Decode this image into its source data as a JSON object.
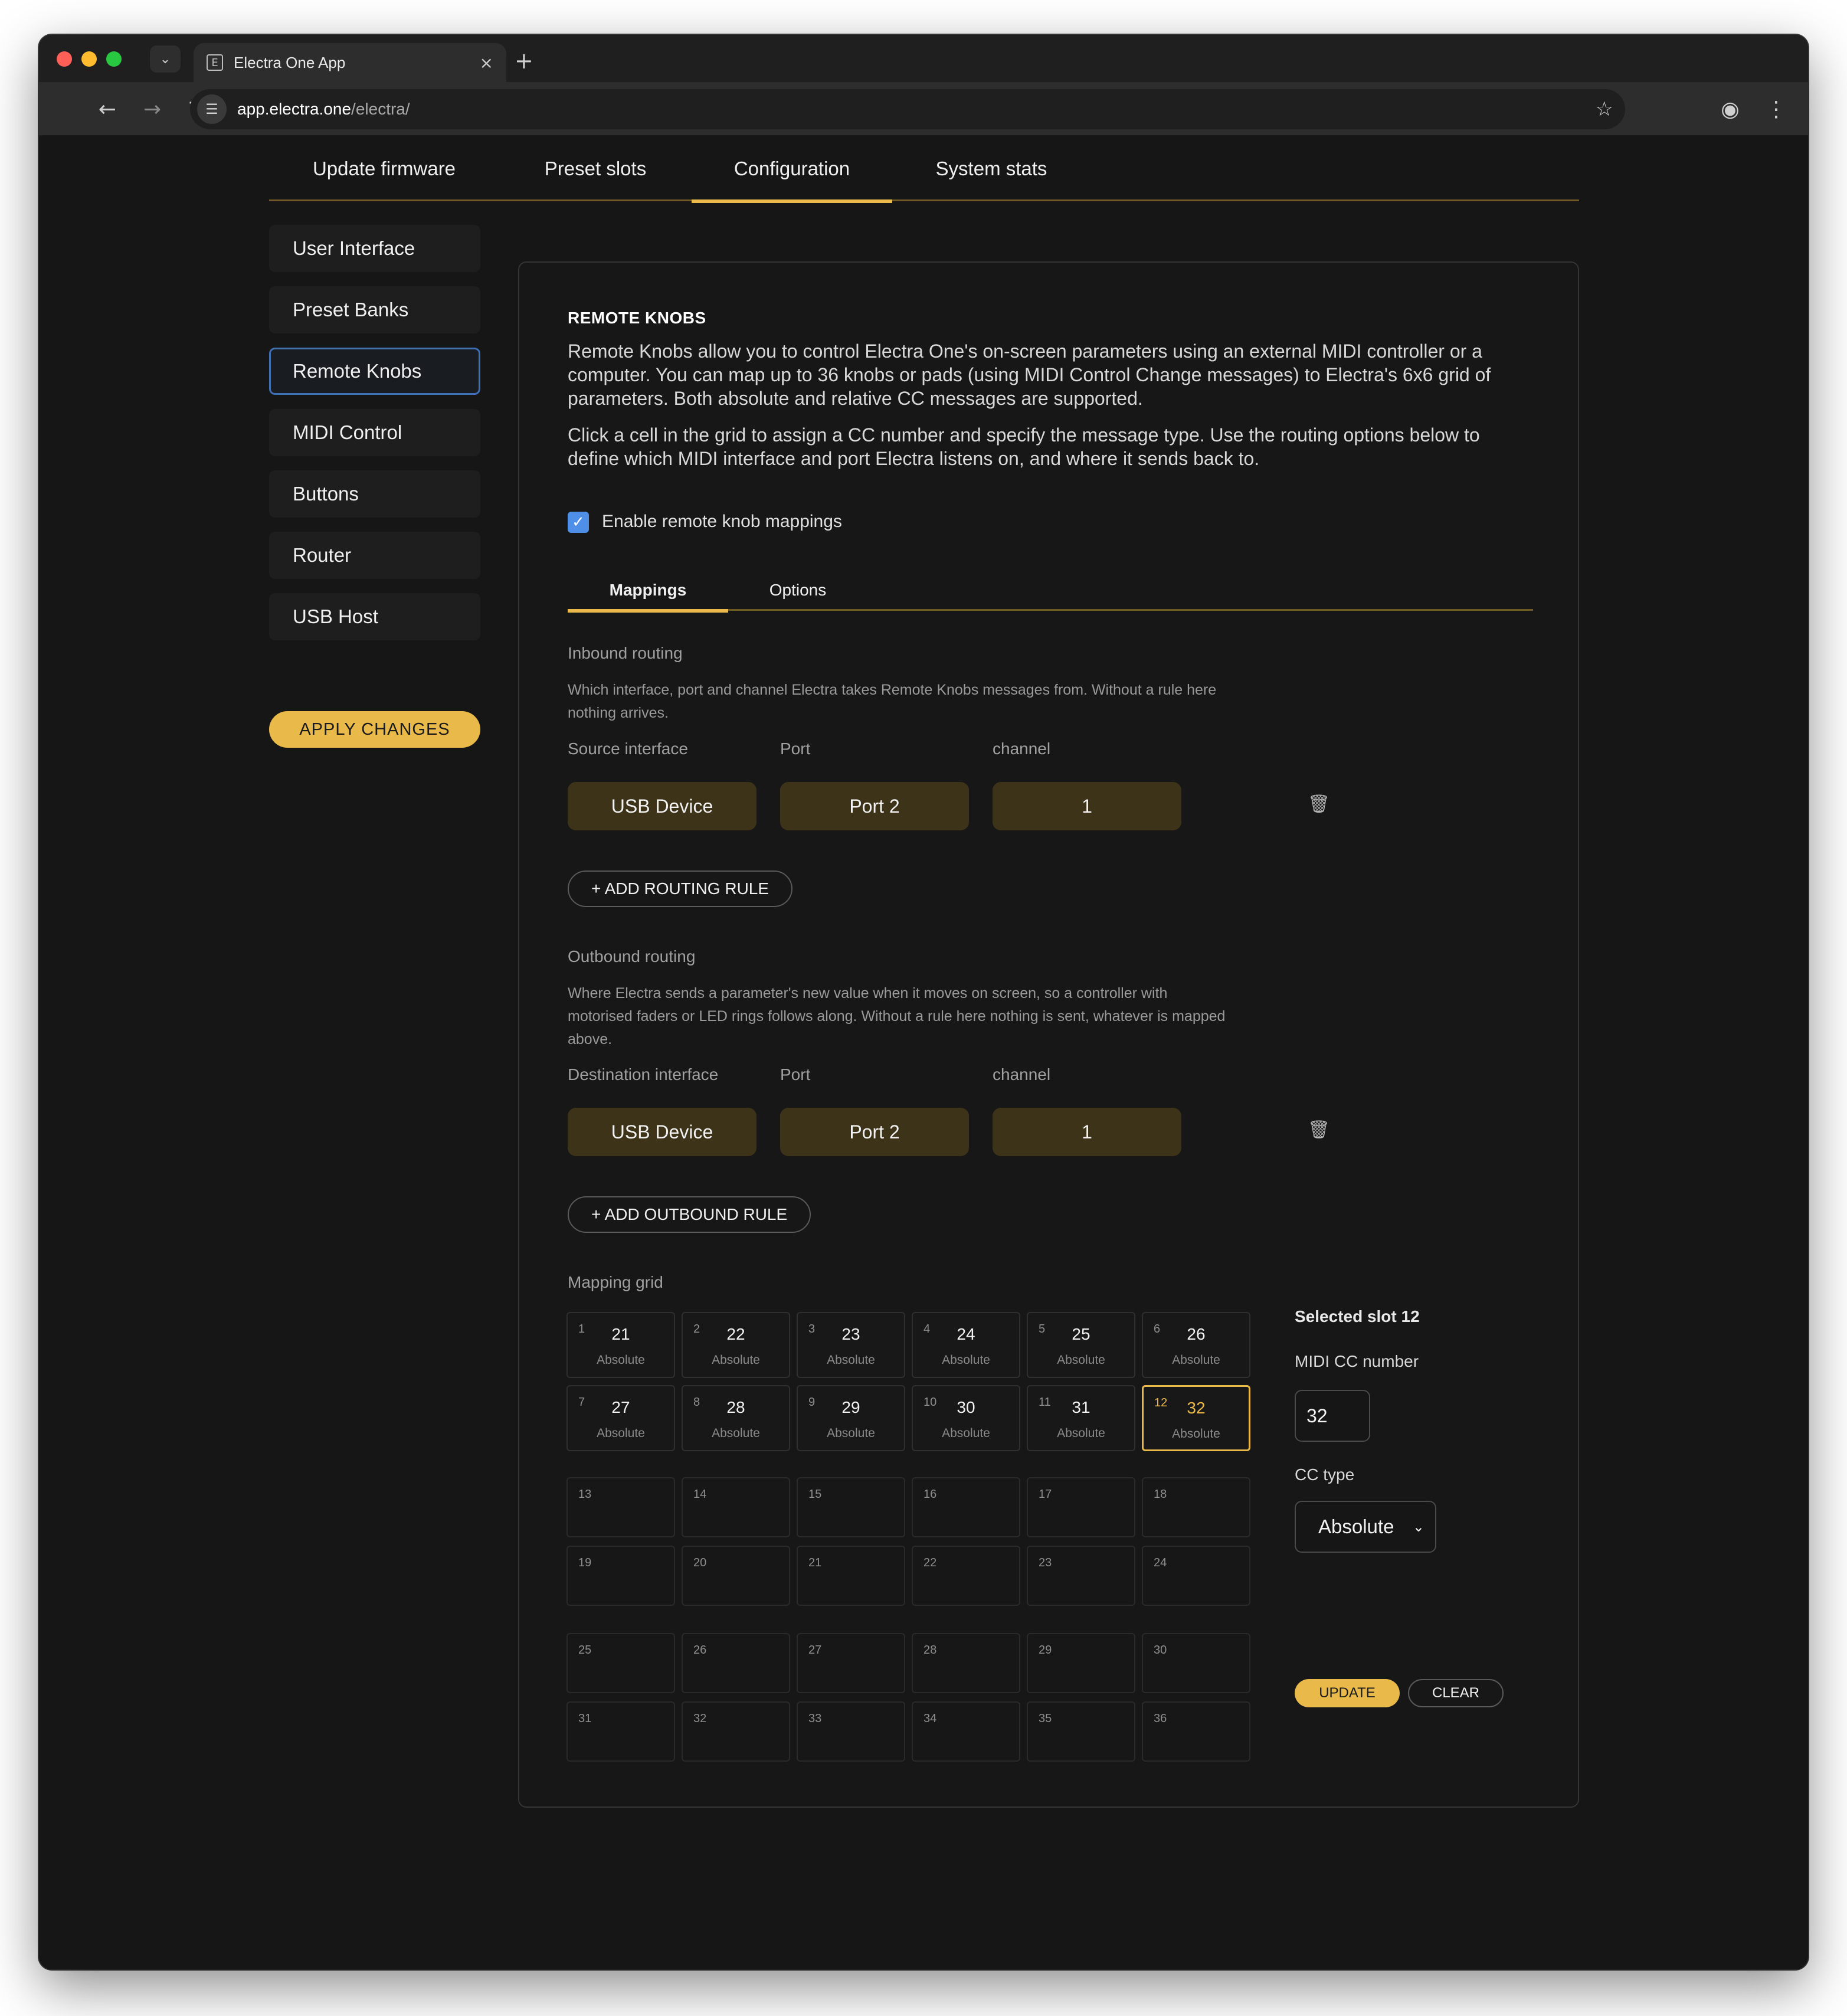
{
  "browser": {
    "tab_title": "Electra One App",
    "url_host": "app.electra.one",
    "url_path": "/electra/",
    "icons": [
      "back-arrow-icon",
      "forward-arrow-icon",
      "reload-icon",
      "site-info-icon",
      "star-icon",
      "profile-icon",
      "kebab-menu-icon"
    ]
  },
  "main_tabs": [
    {
      "label": "Update firmware"
    },
    {
      "label": "Preset slots"
    },
    {
      "label": "Configuration",
      "active": true
    },
    {
      "label": "System stats"
    }
  ],
  "sidebar": {
    "items": [
      {
        "label": "User Interface"
      },
      {
        "label": "Preset Banks"
      },
      {
        "label": "Remote Knobs",
        "active": true
      },
      {
        "label": "MIDI Control"
      },
      {
        "label": "Buttons"
      },
      {
        "label": "Router"
      },
      {
        "label": "USB Host"
      }
    ],
    "apply_label": "APPLY CHANGES"
  },
  "panel": {
    "title": "REMOTE KNOBS",
    "desc1": "Remote Knobs allow you to control Electra One's on-screen parameters using an external MIDI controller or a computer. You can map up to 36 knobs or pads (using MIDI Control Change messages) to Electra's 6x6 grid of parameters. Both absolute and relative CC messages are supported.",
    "desc2": "Click a cell in the grid to assign a CC number and specify the message type. Use the routing options below to define which MIDI interface and port Electra listens on, and where it sends back to.",
    "enable_label": "Enable remote knob mappings",
    "enable_checked": true,
    "sub_tabs": [
      {
        "label": "Mappings",
        "active": true
      },
      {
        "label": "Options"
      }
    ],
    "inbound": {
      "title": "Inbound routing",
      "desc": "Which interface, port and channel Electra takes Remote Knobs messages from. Without a rule here nothing arrives.",
      "col_interface": "Source interface",
      "col_port": "Port",
      "col_channel": "channel",
      "rule": {
        "interface": "USB Device",
        "port": "Port 2",
        "channel": "1"
      },
      "add_label": "+ ADD ROUTING RULE"
    },
    "outbound": {
      "title": "Outbound routing",
      "desc": "Where Electra sends a parameter's new value when it moves on screen, so a controller with motorised faders or LED rings follows along. Without a rule here nothing is sent, whatever is mapped above.",
      "col_interface": "Destination interface",
      "col_port": "Port",
      "col_channel": "channel",
      "rule": {
        "interface": "USB Device",
        "port": "Port 2",
        "channel": "1"
      },
      "add_label": "+ ADD OUTBOUND RULE"
    },
    "grid": {
      "title": "Mapping grid",
      "mapped": [
        {
          "slot": "1",
          "cc": "21",
          "type": "Absolute"
        },
        {
          "slot": "2",
          "cc": "22",
          "type": "Absolute"
        },
        {
          "slot": "3",
          "cc": "23",
          "type": "Absolute"
        },
        {
          "slot": "4",
          "cc": "24",
          "type": "Absolute"
        },
        {
          "slot": "5",
          "cc": "25",
          "type": "Absolute"
        },
        {
          "slot": "6",
          "cc": "26",
          "type": "Absolute"
        },
        {
          "slot": "7",
          "cc": "27",
          "type": "Absolute"
        },
        {
          "slot": "8",
          "cc": "28",
          "type": "Absolute"
        },
        {
          "slot": "9",
          "cc": "29",
          "type": "Absolute"
        },
        {
          "slot": "10",
          "cc": "30",
          "type": "Absolute"
        },
        {
          "slot": "11",
          "cc": "31",
          "type": "Absolute"
        },
        {
          "slot": "12",
          "cc": "32",
          "type": "Absolute",
          "selected": true
        }
      ],
      "empty_slots": [
        "13",
        "14",
        "15",
        "16",
        "17",
        "18",
        "19",
        "20",
        "21",
        "22",
        "23",
        "24",
        "25",
        "26",
        "27",
        "28",
        "29",
        "30",
        "31",
        "32",
        "33",
        "34",
        "35",
        "36"
      ]
    },
    "editor": {
      "title": "Selected slot 12",
      "cc_label": "MIDI CC number",
      "cc_value": "32",
      "type_label": "CC type",
      "type_value": "Absolute",
      "update_label": "UPDATE",
      "clear_label": "CLEAR"
    }
  },
  "colors": {
    "accent": "#e9b949",
    "field_bg": "#3d3319",
    "active_outline": "#3f6fb4",
    "checkbox": "#4f8fe8"
  }
}
